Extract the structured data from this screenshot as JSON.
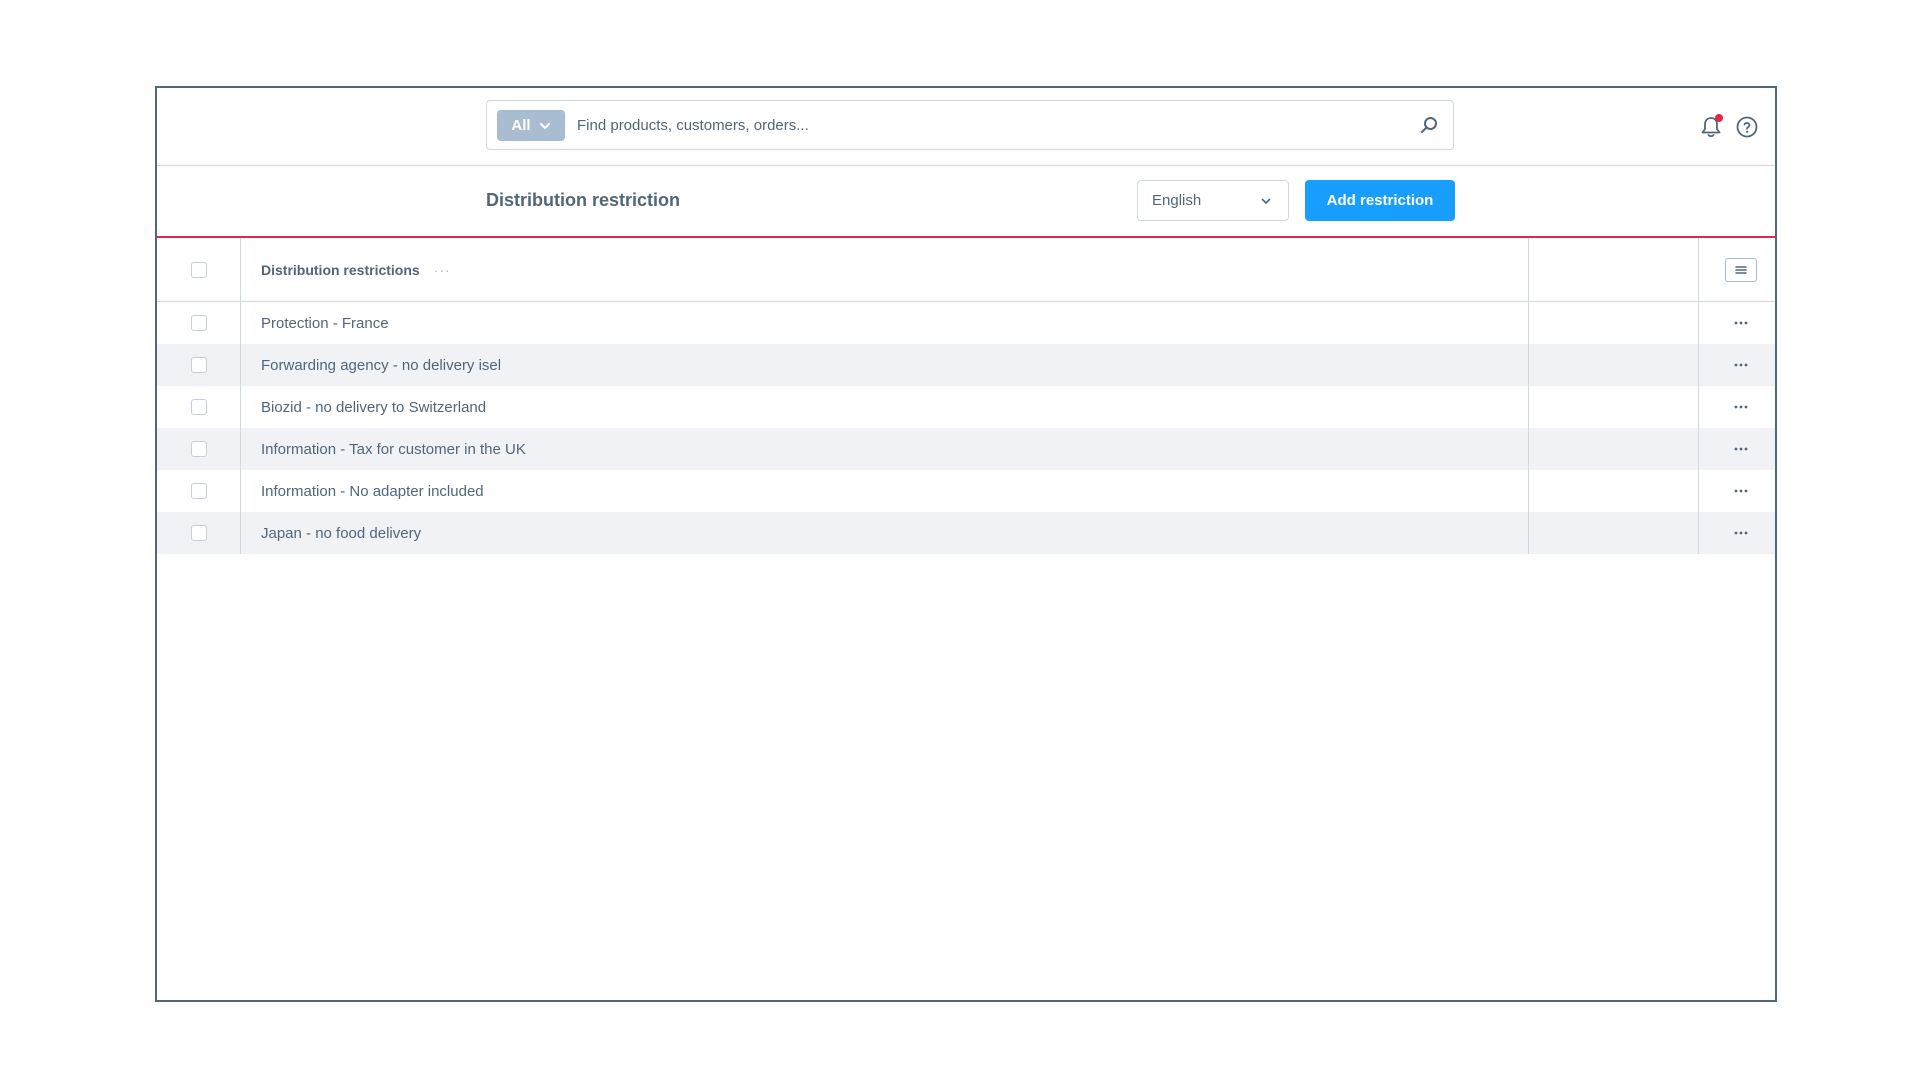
{
  "search": {
    "type_label": "All",
    "placeholder": "Find products, customers, orders..."
  },
  "header_icons": [
    "bell-icon",
    "help-icon"
  ],
  "page": {
    "title": "Distribution restriction",
    "language": "English",
    "add_button": "Add restriction"
  },
  "grid": {
    "column_header": "Distribution restrictions",
    "header_dots": "···",
    "rows": [
      {
        "name": "Protection - France"
      },
      {
        "name": "Forwarding agency - no delivery isel"
      },
      {
        "name": "Biozid - no delivery to Switzerland"
      },
      {
        "name": "Information - Tax for customer in the UK"
      },
      {
        "name": "Information - No adapter included"
      },
      {
        "name": "Japan - no food delivery"
      }
    ]
  },
  "colors": {
    "primary": "#189eff",
    "accent_border": "#de294c",
    "text": "#52667a",
    "row_stripe": "#f0f2f5"
  }
}
